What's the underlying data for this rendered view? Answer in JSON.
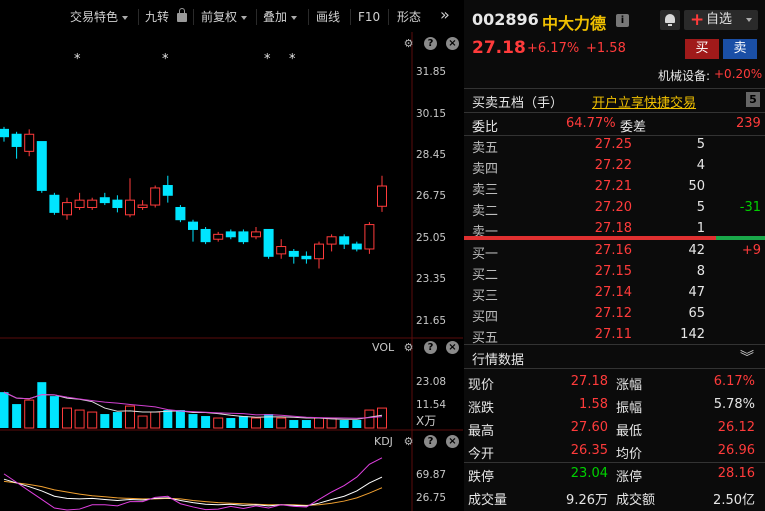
{
  "toolbar": {
    "items": [
      "交易特色",
      "九转",
      "前复权",
      "叠加",
      "画线",
      "F10",
      "形态"
    ],
    "expand_glyph": "»"
  },
  "main_pane": {
    "y_ticks": [
      "31.85",
      "30.15",
      "28.45",
      "26.75",
      "25.05",
      "23.35",
      "21.65"
    ],
    "star_marker": "*"
  },
  "vol_pane": {
    "label": "VOL",
    "y_ticks": [
      "23.08",
      "11.54"
    ],
    "unit": "X万"
  },
  "kdj_pane": {
    "label": "KDJ",
    "y_ticks": [
      "69.87",
      "26.75"
    ]
  },
  "stock": {
    "code": "002896",
    "name": "中大力德",
    "price": "27.18",
    "change_pct": "+6.17%",
    "change": "+1.58",
    "watch_label": "自选",
    "buy_label": "买",
    "sell_label": "卖",
    "sector": "机械设备:",
    "sector_change": "+0.20%"
  },
  "order_book": {
    "title": "买卖五档（手）",
    "link": "开户立享快捷交易",
    "level_badge": "5",
    "ratio_label": "委比",
    "ratio_value": "64.77%",
    "diff_label": "委差",
    "diff_value": "239",
    "asks": [
      {
        "label": "卖五",
        "price": "27.25",
        "volume": "5",
        "delta": ""
      },
      {
        "label": "卖四",
        "price": "27.22",
        "volume": "4",
        "delta": ""
      },
      {
        "label": "卖三",
        "price": "27.21",
        "volume": "50",
        "delta": ""
      },
      {
        "label": "卖二",
        "price": "27.20",
        "volume": "5",
        "delta": "-31"
      },
      {
        "label": "卖一",
        "price": "27.18",
        "volume": "1",
        "delta": ""
      }
    ],
    "bids": [
      {
        "label": "买一",
        "price": "27.16",
        "volume": "42",
        "delta": "+9"
      },
      {
        "label": "买二",
        "price": "27.15",
        "volume": "8",
        "delta": ""
      },
      {
        "label": "买三",
        "price": "27.14",
        "volume": "47",
        "delta": ""
      },
      {
        "label": "买四",
        "price": "27.12",
        "volume": "65",
        "delta": ""
      },
      {
        "label": "买五",
        "price": "27.11",
        "volume": "142",
        "delta": ""
      }
    ]
  },
  "quote": {
    "title": "行情数据",
    "rows": [
      {
        "l1": "现价",
        "v1": "27.18",
        "c1": "red",
        "l2": "涨幅",
        "v2": "6.17%",
        "c2": "red"
      },
      {
        "l1": "涨跌",
        "v1": "1.58",
        "c1": "red",
        "l2": "振幅",
        "v2": "5.78%",
        "c2": "white"
      },
      {
        "l1": "最高",
        "v1": "27.60",
        "c1": "red",
        "l2": "最低",
        "v2": "26.12",
        "c2": "red"
      },
      {
        "l1": "今开",
        "v1": "26.35",
        "c1": "red",
        "l2": "均价",
        "v2": "26.96",
        "c2": "red"
      },
      {
        "l1": "跌停",
        "v1": "23.04",
        "c1": "green",
        "l2": "涨停",
        "v2": "28.16",
        "c2": "red"
      },
      {
        "l1": "成交量",
        "v1": "9.26万",
        "c1": "white",
        "l2": "成交额",
        "v2": "2.50亿",
        "c2": "white"
      }
    ]
  },
  "chart_data": {
    "type": "candlestick",
    "y_range": [
      21.65,
      31.85
    ],
    "candles": [
      {
        "o": 29.2,
        "c": 29.5,
        "h": 29.6,
        "l": 29.0,
        "up": false
      },
      {
        "o": 29.3,
        "c": 28.8,
        "h": 29.4,
        "l": 28.3,
        "up": false
      },
      {
        "o": 28.6,
        "c": 29.3,
        "h": 29.5,
        "l": 28.4,
        "up": true
      },
      {
        "o": 29.0,
        "c": 27.0,
        "h": 29.0,
        "l": 26.9,
        "up": false
      },
      {
        "o": 26.8,
        "c": 26.1,
        "h": 26.9,
        "l": 26.0,
        "up": false
      },
      {
        "o": 26.0,
        "c": 26.5,
        "h": 26.7,
        "l": 25.8,
        "up": true
      },
      {
        "o": 26.3,
        "c": 26.6,
        "h": 26.9,
        "l": 26.2,
        "up": true
      },
      {
        "o": 26.3,
        "c": 26.6,
        "h": 26.7,
        "l": 26.2,
        "up": true
      },
      {
        "o": 26.7,
        "c": 26.5,
        "h": 26.9,
        "l": 26.4,
        "up": false
      },
      {
        "o": 26.6,
        "c": 26.3,
        "h": 26.8,
        "l": 26.1,
        "up": false
      },
      {
        "o": 26.0,
        "c": 26.6,
        "h": 27.5,
        "l": 25.9,
        "up": true
      },
      {
        "o": 26.3,
        "c": 26.4,
        "h": 26.6,
        "l": 26.2,
        "up": true
      },
      {
        "o": 26.4,
        "c": 27.1,
        "h": 27.2,
        "l": 26.3,
        "up": true
      },
      {
        "o": 27.2,
        "c": 26.8,
        "h": 27.6,
        "l": 26.5,
        "up": false
      },
      {
        "o": 26.3,
        "c": 25.8,
        "h": 26.4,
        "l": 25.7,
        "up": false
      },
      {
        "o": 25.7,
        "c": 25.4,
        "h": 25.8,
        "l": 24.9,
        "up": false
      },
      {
        "o": 25.4,
        "c": 24.9,
        "h": 25.5,
        "l": 24.8,
        "up": false
      },
      {
        "o": 25.0,
        "c": 25.2,
        "h": 25.3,
        "l": 24.9,
        "up": true
      },
      {
        "o": 25.3,
        "c": 25.1,
        "h": 25.4,
        "l": 25.0,
        "up": false
      },
      {
        "o": 25.3,
        "c": 24.9,
        "h": 25.4,
        "l": 24.8,
        "up": false
      },
      {
        "o": 25.1,
        "c": 25.3,
        "h": 25.5,
        "l": 25.0,
        "up": true
      },
      {
        "o": 25.4,
        "c": 24.3,
        "h": 25.4,
        "l": 24.2,
        "up": false
      },
      {
        "o": 24.4,
        "c": 24.7,
        "h": 25.0,
        "l": 24.2,
        "up": true
      },
      {
        "o": 24.5,
        "c": 24.3,
        "h": 24.6,
        "l": 24.0,
        "up": false
      },
      {
        "o": 24.3,
        "c": 24.2,
        "h": 24.5,
        "l": 24.0,
        "up": false
      },
      {
        "o": 24.2,
        "c": 24.8,
        "h": 24.9,
        "l": 23.8,
        "up": true
      },
      {
        "o": 24.8,
        "c": 25.1,
        "h": 25.2,
        "l": 24.5,
        "up": true
      },
      {
        "o": 25.1,
        "c": 24.8,
        "h": 25.2,
        "l": 24.6,
        "up": false
      },
      {
        "o": 24.8,
        "c": 24.6,
        "h": 24.9,
        "l": 24.5,
        "up": false
      },
      {
        "o": 24.6,
        "c": 25.6,
        "h": 25.7,
        "l": 24.4,
        "up": true
      },
      {
        "o": 26.35,
        "c": 27.18,
        "h": 27.6,
        "l": 26.12,
        "up": true
      }
    ],
    "vol_bars": [
      {
        "v": 18,
        "up": false
      },
      {
        "v": 12,
        "up": false
      },
      {
        "v": 14,
        "up": true
      },
      {
        "v": 23,
        "up": false
      },
      {
        "v": 16,
        "up": false
      },
      {
        "v": 10,
        "up": true
      },
      {
        "v": 9,
        "up": true
      },
      {
        "v": 8,
        "up": true
      },
      {
        "v": 7,
        "up": false
      },
      {
        "v": 8,
        "up": false
      },
      {
        "v": 11,
        "up": true
      },
      {
        "v": 6,
        "up": true
      },
      {
        "v": 8,
        "up": true
      },
      {
        "v": 9,
        "up": false
      },
      {
        "v": 9,
        "up": false
      },
      {
        "v": 7,
        "up": false
      },
      {
        "v": 6,
        "up": false
      },
      {
        "v": 5,
        "up": true
      },
      {
        "v": 5,
        "up": false
      },
      {
        "v": 6,
        "up": false
      },
      {
        "v": 5,
        "up": true
      },
      {
        "v": 7,
        "up": false
      },
      {
        "v": 5,
        "up": true
      },
      {
        "v": 4,
        "up": false
      },
      {
        "v": 4,
        "up": false
      },
      {
        "v": 5,
        "up": true
      },
      {
        "v": 5,
        "up": true
      },
      {
        "v": 4,
        "up": false
      },
      {
        "v": 4,
        "up": false
      },
      {
        "v": 9,
        "up": true
      },
      {
        "v": 10,
        "up": true
      }
    ],
    "kdj": {
      "k": [
        62,
        55,
        48,
        40,
        30,
        26,
        25,
        26,
        24,
        22,
        24,
        23,
        26,
        27,
        22,
        18,
        15,
        14,
        15,
        13,
        14,
        12,
        14,
        13,
        12,
        17,
        24,
        30,
        40,
        55,
        66
      ],
      "d": [
        58,
        55,
        52,
        48,
        42,
        38,
        34,
        31,
        29,
        27,
        26,
        25,
        25,
        26,
        25,
        22,
        20,
        18,
        17,
        16,
        15,
        14,
        14,
        14,
        13,
        14,
        17,
        21,
        27,
        36,
        46
      ],
      "j": [
        72,
        56,
        40,
        24,
        8,
        4,
        6,
        14,
        14,
        12,
        20,
        20,
        28,
        30,
        16,
        10,
        5,
        6,
        11,
        7,
        12,
        8,
        14,
        11,
        10,
        24,
        38,
        50,
        66,
        90,
        102
      ]
    }
  }
}
